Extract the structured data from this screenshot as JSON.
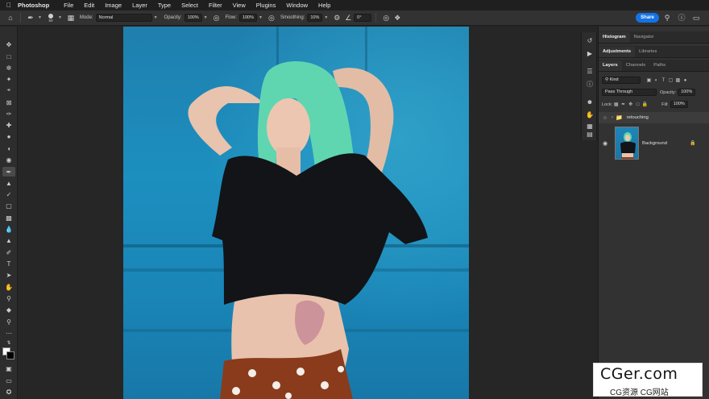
{
  "menubar": {
    "app_name": "Photoshop",
    "items": [
      "File",
      "Edit",
      "Image",
      "Layer",
      "Type",
      "Select",
      "Filter",
      "View",
      "Plugins",
      "Window",
      "Help"
    ]
  },
  "options": {
    "brush_size": "50",
    "mode_label": "Mode:",
    "mode_value": "Normal",
    "opacity_label": "Opacity:",
    "opacity_value": "100%",
    "flow_label": "Flow:",
    "flow_value": "100%",
    "smoothing_label": "Smoothing:",
    "smoothing_value": "10%",
    "angle_value": "0°",
    "share_label": "Share"
  },
  "panels": {
    "top_tabs": [
      "Histogram",
      "Navigator"
    ],
    "mid_tabs": [
      "Adjustments",
      "Libraries"
    ],
    "layer_tabs": [
      "Layers",
      "Channels",
      "Paths"
    ],
    "filter_kind": "Kind",
    "blend_mode": "Pass Through",
    "opacity_label": "Opacity:",
    "opacity_value": "100%",
    "lock_label": "Lock:",
    "fill_label": "Fill:",
    "fill_value": "100%",
    "layers": [
      {
        "name": "retouching",
        "type": "group"
      },
      {
        "name": "Background",
        "type": "layer"
      }
    ]
  },
  "watermark": {
    "main": "CGer.com",
    "sub": "CG资源 CG网站"
  },
  "colors": {
    "accent": "#1473e6",
    "backdrop": "#1c8fbf",
    "hair": "#5fd6b0"
  }
}
